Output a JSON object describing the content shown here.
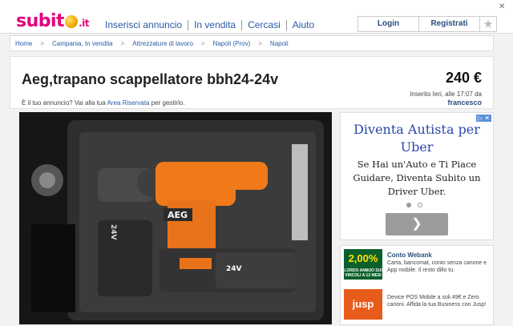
{
  "header": {
    "logo_main": "subit",
    "logo_tld": ".it",
    "nav": [
      "Inserisci annuncio",
      "In vendita",
      "Cercasi",
      "Aiuto"
    ],
    "login": "Login",
    "register": "Registrati",
    "star": "★",
    "close": "✕"
  },
  "breadcrumb": [
    "Home",
    "Campania, In vendita",
    "Attrezzature di lavoro",
    "Napoli (Prov)",
    "Napoli"
  ],
  "breadcrumb_sep": ">",
  "listing": {
    "title": "Aeg,trapano scappellatore bbh24-24v",
    "price": "240 €",
    "inserted": "Inserito Ieri, alle 17:07 da",
    "seller": "francesco",
    "owner_prefix": "È il tuo annuncio? Vai alla tua",
    "owner_link": "Area Riservata",
    "owner_suffix": "per gestirlo."
  },
  "photo": {
    "brand": "AEG",
    "battery_label": "24V",
    "colors": {
      "body": "#f07a1a",
      "dark": "#2b2b2b",
      "foam": "#3a3a3a"
    }
  },
  "ad": {
    "headline": [
      "Diventa Autista per",
      "Uber"
    ],
    "body": [
      "Se Hai un'Auto e Ti Piace",
      "Guidare, Diventa Subito un",
      "Driver Uber."
    ],
    "next": "❯",
    "adchoices": "▷ ✕"
  },
  "side_items": [
    {
      "thumb_big": "2,00%",
      "thumb_small": "LORDO ANNUO SUI VINCOLI A 12 MESI",
      "title": "Conto Webank",
      "text": "Carta, bancomat, conto senza canone e App mobile. Il resto dillo tu."
    },
    {
      "thumb_big": "jusp",
      "title": "",
      "text": "Device POS Mobile a soli 49€ e Zero canoni. Affida la tua Business con Jusp!"
    }
  ],
  "colors": {
    "brand": "#e4007b",
    "link": "#2a5aa6",
    "ad_headline": "#2a48a8"
  }
}
